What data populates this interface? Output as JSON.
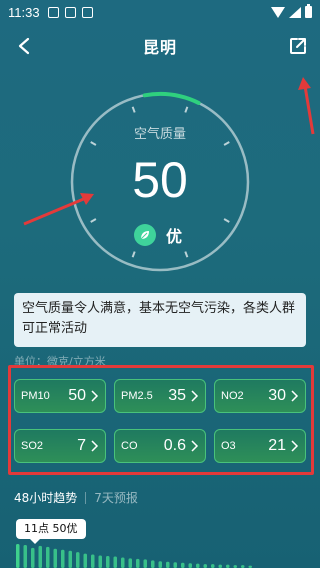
{
  "status_bar": {
    "time": "11:33"
  },
  "header": {
    "title": "昆明"
  },
  "gauge": {
    "label": "空气质量",
    "value": "50",
    "grade": "优",
    "level_fraction": 0.1,
    "accent_color": "#2fd07e"
  },
  "description": "空气质量令人满意，基本无空气污染，各类人群可正常活动",
  "unit": "单位：微克/立方米",
  "pollutants": [
    {
      "name": "PM10",
      "value": "50"
    },
    {
      "name": "PM2.5",
      "value": "35"
    },
    {
      "name": "NO2",
      "value": "30"
    },
    {
      "name": "SO2",
      "value": "7"
    },
    {
      "name": "CO",
      "value": "0.6"
    },
    {
      "name": "O3",
      "value": "21"
    }
  ],
  "trend": {
    "tab_48h": "48小时趋势",
    "tab_7d": "7天预报",
    "tooltip": "11点 50优",
    "bar_color": "#3ed18d",
    "values": [
      50,
      48,
      42,
      46,
      44,
      40,
      38,
      36,
      33,
      30,
      28,
      26,
      25,
      24,
      22,
      20,
      19,
      18,
      16,
      14,
      13,
      12,
      11,
      10,
      9,
      8,
      8,
      7,
      7,
      6,
      6,
      5
    ]
  },
  "annotations": {
    "color": "#e33a3a"
  }
}
